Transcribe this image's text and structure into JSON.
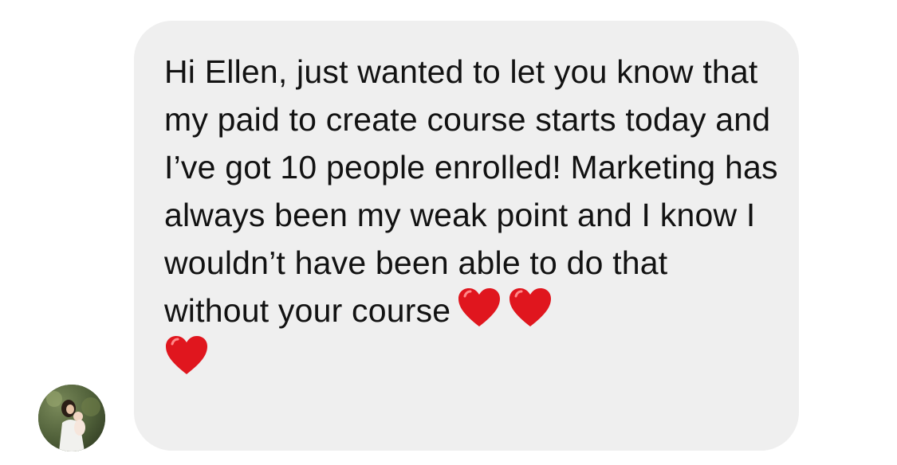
{
  "message": {
    "text": "Hi Ellen, just wanted to let you know that my paid to create course starts today and I’ve got 10 people enrolled! Marketing has always been my weak point and I know I wouldn’t have been able to do that without your course",
    "reactions": [
      "heart-emoji",
      "heart-emoji",
      "heart-emoji"
    ]
  },
  "sender": {
    "avatar": "avatar-photo"
  },
  "colors": {
    "bubble": "#efefef",
    "text": "#121212",
    "heart": "#e0161e"
  }
}
